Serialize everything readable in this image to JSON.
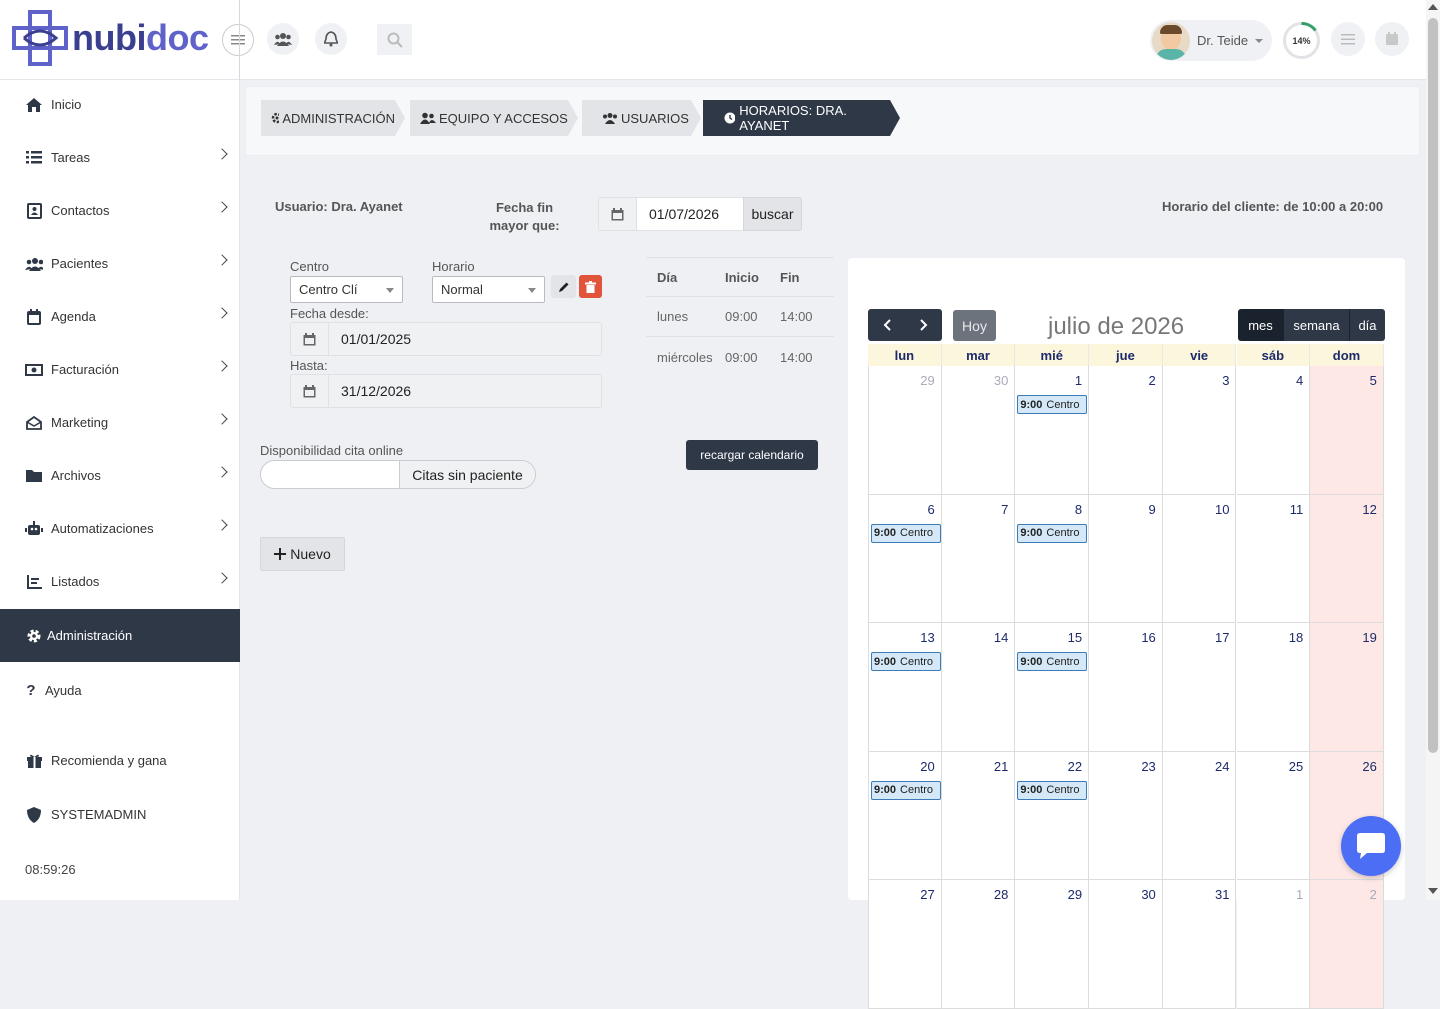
{
  "brand": {
    "name_part1": "nubi",
    "name_part2": "doc",
    "primary": "#3b3f8f",
    "accent": "#4c6ef5",
    "dark": "#2e3847"
  },
  "topbar": {
    "user_name": "Dr. Teide",
    "progress_label": "14%",
    "progress_value": 0.14
  },
  "sidebar": {
    "items": [
      {
        "label": "Inicio",
        "icon": "home-icon"
      },
      {
        "label": "Tareas",
        "icon": "list-icon"
      },
      {
        "label": "Contactos",
        "icon": "address-book-icon"
      },
      {
        "label": "Pacientes",
        "icon": "users-icon"
      },
      {
        "label": "Agenda",
        "icon": "calendar-icon"
      },
      {
        "label": "Facturación",
        "icon": "money-icon"
      },
      {
        "label": "Marketing",
        "icon": "envelope-icon"
      },
      {
        "label": "Archivos",
        "icon": "folder-icon"
      },
      {
        "label": "Automatizaciones",
        "icon": "robot-icon"
      },
      {
        "label": "Listados",
        "icon": "chart-icon"
      },
      {
        "label": "Administración",
        "icon": "gear-icon"
      },
      {
        "label": "Ayuda",
        "icon": "question-icon"
      },
      {
        "label": "Recomienda y gana",
        "icon": "gift-icon"
      },
      {
        "label": "SYSTEMADMIN",
        "icon": "shield-icon"
      }
    ],
    "clock": "08:59:26"
  },
  "breadcrumb": [
    "ADMINISTRACIÓN",
    "EQUIPO Y ACCESOS",
    "USUARIOS",
    "HORARIOS: DRA. AYANET"
  ],
  "filter": {
    "user_label": "Usuario: Dra. Ayanet",
    "date_label_1": "Fecha fin",
    "date_label_2": "mayor que:",
    "date_value": "01/07/2026",
    "search_button": "buscar",
    "client_hours": "Horario del cliente: de 10:00 a 20:00"
  },
  "form": {
    "centro_label": "Centro",
    "centro_value": "Centro Clí",
    "horario_label": "Horario",
    "horario_value": "Normal",
    "desde_label": "Fecha desde:",
    "desde_value": "01/01/2025",
    "hasta_label": "Hasta:",
    "hasta_value": "31/12/2026",
    "online_label": "Disponibilidad cita online",
    "online_toggle": "Citas sin paciente",
    "reload_button": "recargar calendario",
    "new_button": "Nuevo"
  },
  "schedule": {
    "headers": [
      "Día",
      "Inicio",
      "Fin"
    ],
    "rows": [
      [
        "lunes",
        "09:00",
        "14:00"
      ],
      [
        "miércoles",
        "09:00",
        "14:00"
      ]
    ]
  },
  "calendar": {
    "title": "julio de 2026",
    "today": "Hoy",
    "views": [
      "mes",
      "semana",
      "día"
    ],
    "days": [
      "lun",
      "mar",
      "mié",
      "jue",
      "vie",
      "sáb",
      "dom"
    ],
    "event_time": "9:00",
    "event_title": "Centro",
    "weeks": [
      [
        "29",
        "30",
        "1",
        "2",
        "3",
        "4",
        "5"
      ],
      [
        "6",
        "7",
        "8",
        "9",
        "10",
        "11",
        "12"
      ],
      [
        "13",
        "14",
        "15",
        "16",
        "17",
        "18",
        "19"
      ],
      [
        "20",
        "21",
        "22",
        "23",
        "24",
        "25",
        "26"
      ],
      [
        "27",
        "28",
        "29",
        "30",
        "31",
        "1",
        "2"
      ]
    ]
  }
}
